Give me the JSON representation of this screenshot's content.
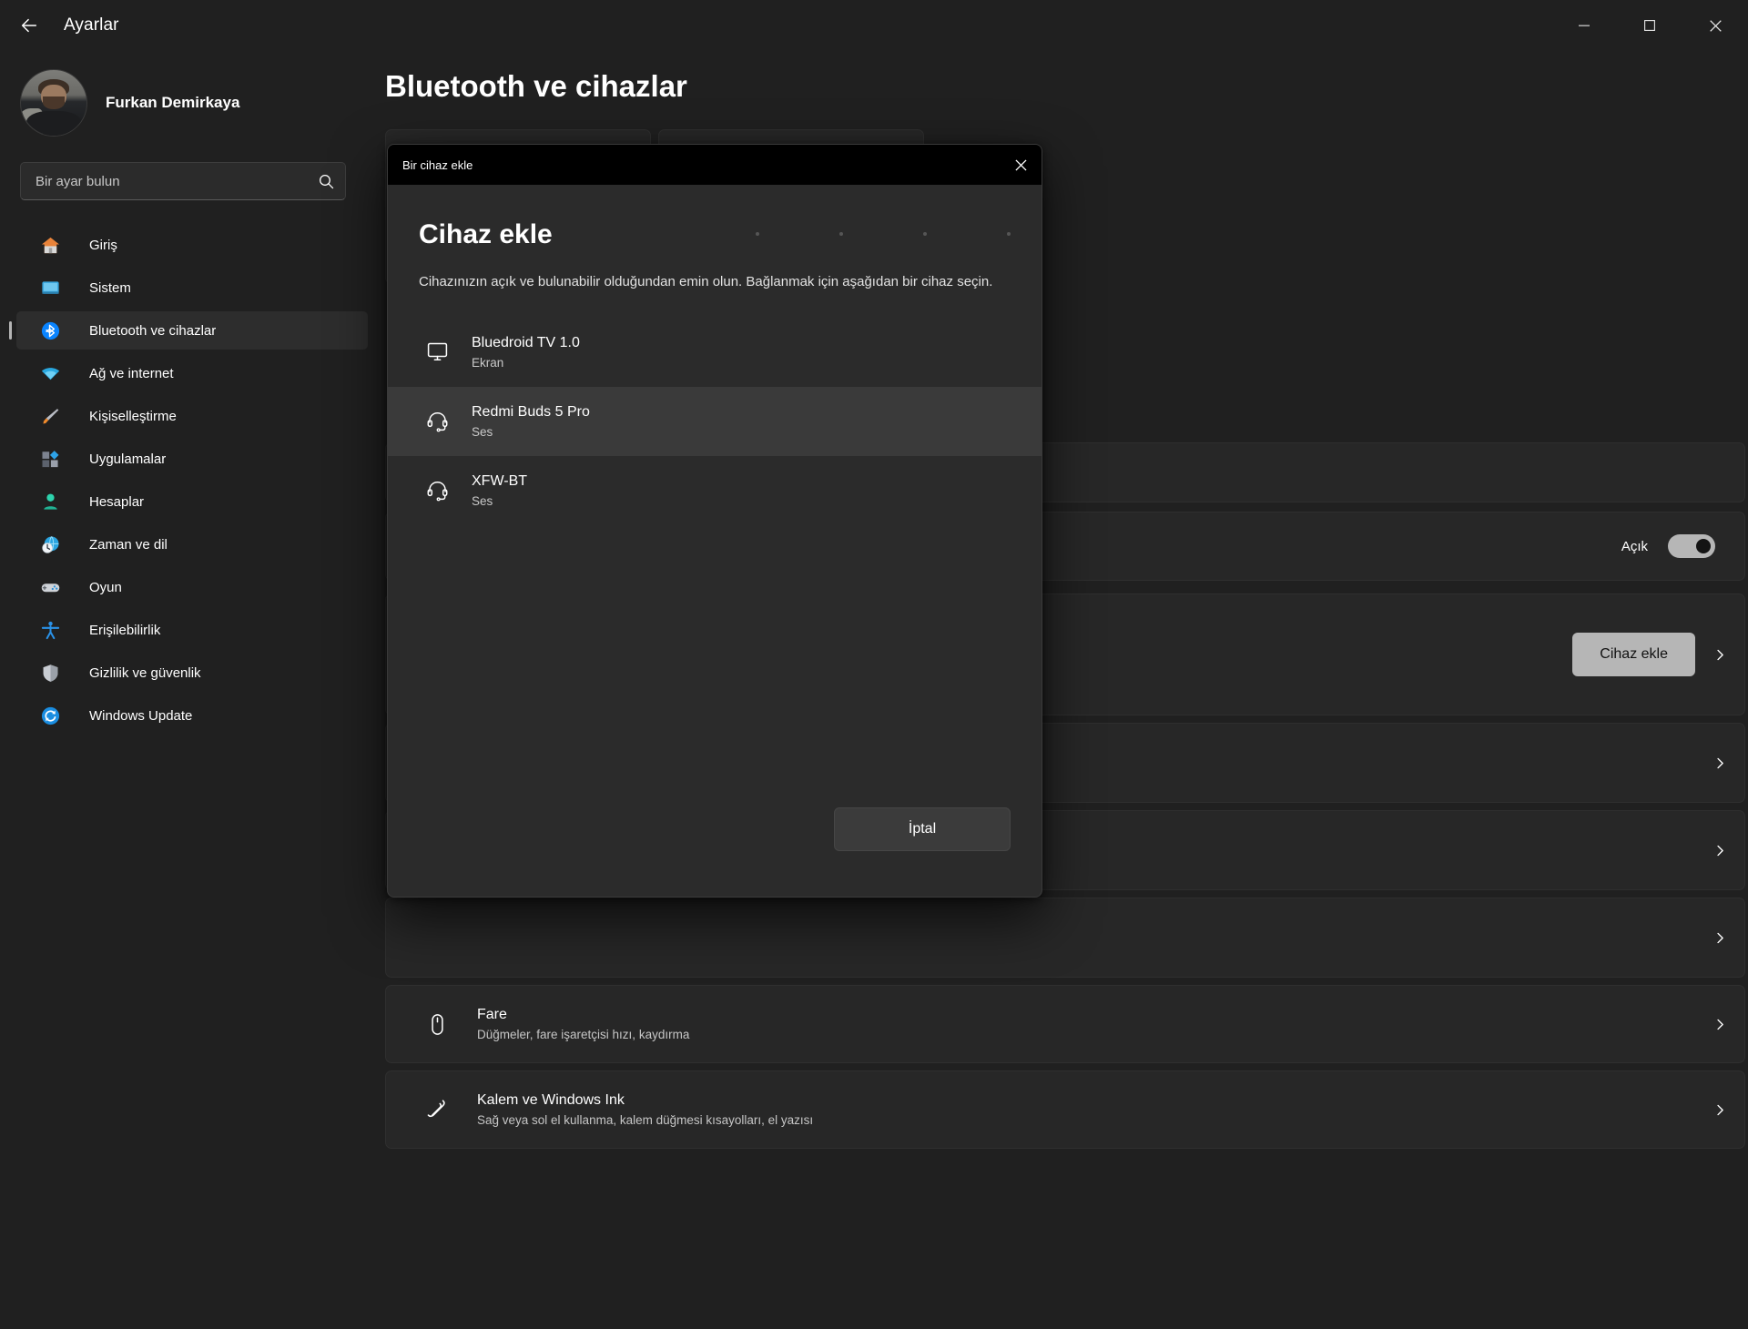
{
  "window": {
    "app_title": "Ayarlar",
    "back_icon": "arrow-left-icon",
    "minimize_icon": "minimize-icon",
    "maximize_icon": "maximize-icon",
    "close_icon": "close-icon"
  },
  "sidebar": {
    "profile": {
      "name": "Furkan Demirkaya",
      "avatar_icon": "user-avatar"
    },
    "search": {
      "placeholder": "Bir ayar bulun",
      "value": "",
      "icon": "search-icon"
    },
    "items": [
      {
        "label": "Giriş",
        "icon": "home-icon",
        "active": false
      },
      {
        "label": "Sistem",
        "icon": "system-icon",
        "active": false
      },
      {
        "label": "Bluetooth ve cihazlar",
        "icon": "bluetooth-icon",
        "active": true
      },
      {
        "label": "Ağ ve internet",
        "icon": "wifi-icon",
        "active": false
      },
      {
        "label": "Kişiselleştirme",
        "icon": "paintbrush-icon",
        "active": false
      },
      {
        "label": "Uygulamalar",
        "icon": "apps-icon",
        "active": false
      },
      {
        "label": "Hesaplar",
        "icon": "accounts-icon",
        "active": false
      },
      {
        "label": "Zaman ve dil",
        "icon": "time-language-icon",
        "active": false
      },
      {
        "label": "Oyun",
        "icon": "gamepad-icon",
        "active": false
      },
      {
        "label": "Erişilebilirlik",
        "icon": "accessibility-icon",
        "active": false
      },
      {
        "label": "Gizlilik ve güvenlik",
        "icon": "shield-icon",
        "active": false
      },
      {
        "label": "Windows Update",
        "icon": "windows-update-icon",
        "active": false
      }
    ]
  },
  "main": {
    "page_title": "Bluetooth ve cihazlar",
    "bluetooth_row": {
      "toggle_label": "Açık",
      "toggle_state": "on"
    },
    "add_device_row": {
      "button_label": "Cihaz ekle",
      "chevron_icon": "chevron-right-icon"
    },
    "plain_rows": [
      {
        "chevron_icon": "chevron-right-icon"
      },
      {
        "chevron_icon": "chevron-right-icon"
      },
      {
        "chevron_icon": "chevron-right-icon"
      }
    ],
    "settings_rows": [
      {
        "title": "Fare",
        "subtitle": "Düğmeler, fare işaretçisi hızı, kaydırma",
        "icon": "mouse-icon",
        "chevron_icon": "chevron-right-icon"
      },
      {
        "title": "Kalem ve Windows Ink",
        "subtitle": "Sağ veya sol el kullanma, kalem düğmesi kısayolları, el yazısı",
        "icon": "pen-icon",
        "chevron_icon": "chevron-right-icon"
      }
    ]
  },
  "dialog": {
    "caption_title": "Bir cihaz ekle",
    "close_icon": "close-icon",
    "heading": "Cihaz ekle",
    "description": "Cihazınızın açık ve bulunabilir olduğundan emin olun. Bağlanmak için aşağıdan bir cihaz seçin.",
    "devices": [
      {
        "name": "Bluedroid TV 1.0",
        "kind": "Ekran",
        "icon": "monitor-icon",
        "selected": false
      },
      {
        "name": "Redmi Buds 5 Pro",
        "kind": "Ses",
        "icon": "headset-icon",
        "selected": true
      },
      {
        "name": "XFW-BT",
        "kind": "Ses",
        "icon": "headset-icon",
        "selected": false
      }
    ],
    "cancel_label": "İptal"
  },
  "colors": {
    "window_bg": "#202020",
    "card_bg": "#272727",
    "dialog_bg": "#2b2b2b",
    "accent": "#b6b6b6",
    "bluetooth_blue": "#0a84ff",
    "selection": "#3a3a3a"
  }
}
